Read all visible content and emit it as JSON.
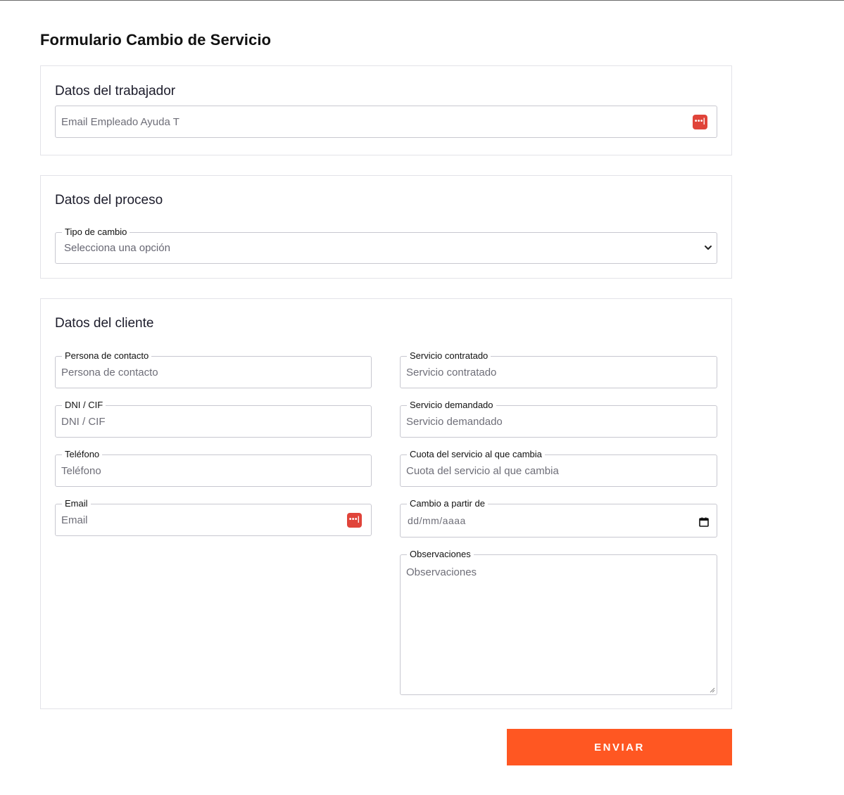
{
  "page": {
    "title": "Formulario Cambio de Servicio"
  },
  "trabajador": {
    "title": "Datos del trabajador",
    "email_placeholder": "Email Empleado Ayuda T"
  },
  "proceso": {
    "title": "Datos del proceso",
    "tipo_label": "Tipo de cambio",
    "tipo_value": "Selecciona una opción"
  },
  "cliente": {
    "title": "Datos del cliente",
    "persona_label": "Persona de contacto",
    "persona_placeholder": "Persona de contacto",
    "dni_label": "DNI / CIF",
    "dni_placeholder": "DNI / CIF",
    "telefono_label": "Teléfono",
    "telefono_placeholder": "Teléfono",
    "email_label": "Email",
    "email_placeholder": "Email",
    "servicio_contratado_label": "Servicio contratado",
    "servicio_contratado_placeholder": "Servicio contratado",
    "servicio_demandado_label": "Servicio demandado",
    "servicio_demandado_placeholder": "Servicio demandado",
    "cuota_label": "Cuota del servicio al que cambia",
    "cuota_placeholder": "Cuota del servicio al que cambia",
    "fecha_label": "Cambio a partir de",
    "fecha_placeholder": "dd/mm/aaaa",
    "observaciones_label": "Observaciones",
    "observaciones_placeholder": "Observaciones"
  },
  "submit": {
    "label": "ENVIAR"
  },
  "icons": {
    "password_manager": "password-manager-icon",
    "select_chevron": "chevron-down-icon",
    "date_picker": "calendar-icon"
  },
  "colors": {
    "accent": "#ff5722",
    "password_manager_icon": "#e0443a",
    "card_border": "#e3e3e8"
  }
}
